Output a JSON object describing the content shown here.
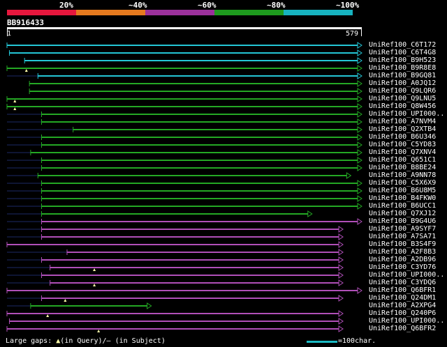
{
  "legend": {
    "segments": [
      {
        "label": "20%",
        "color": "#e6173d"
      },
      {
        "label": "~40%",
        "color": "#e67a1f"
      },
      {
        "label": "~60%",
        "color": "#9b319b"
      },
      {
        "label": "~80%",
        "color": "#1e9a1e"
      },
      {
        "label": "~100%",
        "color": "#17b3c0"
      }
    ]
  },
  "query": {
    "name": "BB916433",
    "start": "1",
    "end": "579",
    "length": 579
  },
  "colors": {
    "cyan": "#24c6d6",
    "green": "#24a824",
    "magenta": "#b04fb8",
    "gap": "#1b2a66",
    "marker": "#ffffaa"
  },
  "hits": [
    {
      "name": "UniRef100_C6T172",
      "color": "cyan",
      "qstart": 1,
      "qend": 579,
      "gap_before": 0
    },
    {
      "name": "UniRef100_C6T4G8",
      "color": "cyan",
      "qstart": 5,
      "qend": 579,
      "gap_before": 0
    },
    {
      "name": "UniRef100_B9H523",
      "color": "cyan",
      "qstart": 30,
      "qend": 579,
      "gap_before": 0
    },
    {
      "name": "UniRef100_B9R8E8",
      "color": "green",
      "qstart": 1,
      "qend": 579,
      "gap_before": 0,
      "marks": [
        33
      ]
    },
    {
      "name": "UniRef100_B9GQ81",
      "color": "cyan",
      "qstart": 52,
      "qend": 579,
      "gap_before": 1
    },
    {
      "name": "UniRef100_A0JQ12",
      "color": "green",
      "qstart": 38,
      "qend": 579,
      "gap_before": 0
    },
    {
      "name": "UniRef100_Q9LQR6",
      "color": "green",
      "qstart": 38,
      "qend": 579,
      "gap_before": 0
    },
    {
      "name": "UniRef100_Q9LNU5",
      "color": "green",
      "qstart": 1,
      "qend": 579,
      "gap_before": 0,
      "marks": [
        14
      ]
    },
    {
      "name": "UniRef100_Q8W456",
      "color": "green",
      "qstart": 1,
      "qend": 579,
      "gap_before": 0,
      "marks": [
        14
      ]
    },
    {
      "name": "UniRef100_UPI000..",
      "color": "green",
      "qstart": 58,
      "qend": 579,
      "gap_before": 1
    },
    {
      "name": "UniRef100_A7NVM4",
      "color": "green",
      "qstart": 58,
      "qend": 579,
      "gap_before": 1
    },
    {
      "name": "UniRef100_Q2XTB4",
      "color": "green",
      "qstart": 110,
      "qend": 579,
      "gap_before": 1
    },
    {
      "name": "UniRef100_B6U346",
      "color": "green",
      "qstart": 58,
      "qend": 579,
      "gap_before": 1
    },
    {
      "name": "UniRef100_C5YD83",
      "color": "green",
      "qstart": 58,
      "qend": 579,
      "gap_before": 1
    },
    {
      "name": "UniRef100_Q7XNV4",
      "color": "green",
      "qstart": 40,
      "qend": 579,
      "gap_before": 1
    },
    {
      "name": "UniRef100_Q651C1",
      "color": "green",
      "qstart": 58,
      "qend": 579,
      "gap_before": 1
    },
    {
      "name": "UniRef100_B8BE24",
      "color": "green",
      "qstart": 58,
      "qend": 579,
      "gap_before": 1
    },
    {
      "name": "UniRef100_A9NN78",
      "color": "green",
      "qstart": 52,
      "qend": 561,
      "gap_before": 1
    },
    {
      "name": "UniRef100_C5X6X9",
      "color": "green",
      "qstart": 58,
      "qend": 579,
      "gap_before": 1
    },
    {
      "name": "UniRef100_B6U8M5",
      "color": "green",
      "qstart": 58,
      "qend": 579,
      "gap_before": 1
    },
    {
      "name": "UniRef100_B4FKW0",
      "color": "green",
      "qstart": 58,
      "qend": 579,
      "gap_before": 1
    },
    {
      "name": "UniRef100_B6UCC1",
      "color": "green",
      "qstart": 58,
      "qend": 579,
      "gap_before": 1
    },
    {
      "name": "UniRef100_Q7XJ12",
      "color": "green",
      "qstart": 58,
      "qend": 497,
      "gap_before": 1
    },
    {
      "name": "UniRef100_B9G4U6",
      "color": "magenta",
      "qstart": 58,
      "qend": 579,
      "gap_before": 1
    },
    {
      "name": "UniRef100_A9SYF7",
      "color": "magenta",
      "qstart": 58,
      "qend": 548,
      "gap_before": 1
    },
    {
      "name": "UniRef100_A7SA71",
      "color": "magenta",
      "qstart": 58,
      "qend": 548,
      "gap_before": 1
    },
    {
      "name": "UniRef100_B3S4F9",
      "color": "magenta",
      "qstart": 1,
      "qend": 548,
      "gap_before": 0
    },
    {
      "name": "UniRef100_A2F8B3",
      "color": "magenta",
      "qstart": 100,
      "qend": 548,
      "gap_before": 1
    },
    {
      "name": "UniRef100_A2DB96",
      "color": "magenta",
      "qstart": 58,
      "qend": 548,
      "gap_before": 1
    },
    {
      "name": "UniRef100_C3YD76",
      "color": "magenta",
      "qstart": 72,
      "qend": 548,
      "gap_before": 1,
      "marks": [
        145
      ]
    },
    {
      "name": "UniRef100_UPI000..",
      "color": "magenta",
      "qstart": 58,
      "qend": 548,
      "gap_before": 1
    },
    {
      "name": "UniRef100_C3YDQ6",
      "color": "magenta",
      "qstart": 72,
      "qend": 548,
      "gap_before": 1,
      "marks": [
        145
      ]
    },
    {
      "name": "UniRef100_Q6BFR1",
      "color": "magenta",
      "qstart": 1,
      "qend": 579,
      "gap_before": 0
    },
    {
      "name": "UniRef100_Q24DM1",
      "color": "magenta",
      "qstart": 58,
      "qend": 548,
      "gap_before": 1,
      "marks": [
        97
      ]
    },
    {
      "name": "UniRef100_A2XPG4",
      "color": "green",
      "qstart": 40,
      "qend": 232,
      "gap_before": 1
    },
    {
      "name": "UniRef100_Q240P6",
      "color": "magenta",
      "qstart": 1,
      "qend": 548,
      "gap_before": 0,
      "marks": [
        68
      ]
    },
    {
      "name": "UniRef100_UPI000..",
      "color": "magenta",
      "qstart": 5,
      "qend": 548,
      "gap_before": 0
    },
    {
      "name": "UniRef100_Q6BFR2",
      "color": "magenta",
      "qstart": 1,
      "qend": 548,
      "gap_before": 0,
      "marks": [
        152
      ]
    }
  ],
  "footer": {
    "large_gaps": "Large gaps:",
    "in_query": "(in Query)/",
    "in_subject": "(in Subject)",
    "triangle": "▲",
    "dash": "–",
    "scale_label": "=100char."
  }
}
